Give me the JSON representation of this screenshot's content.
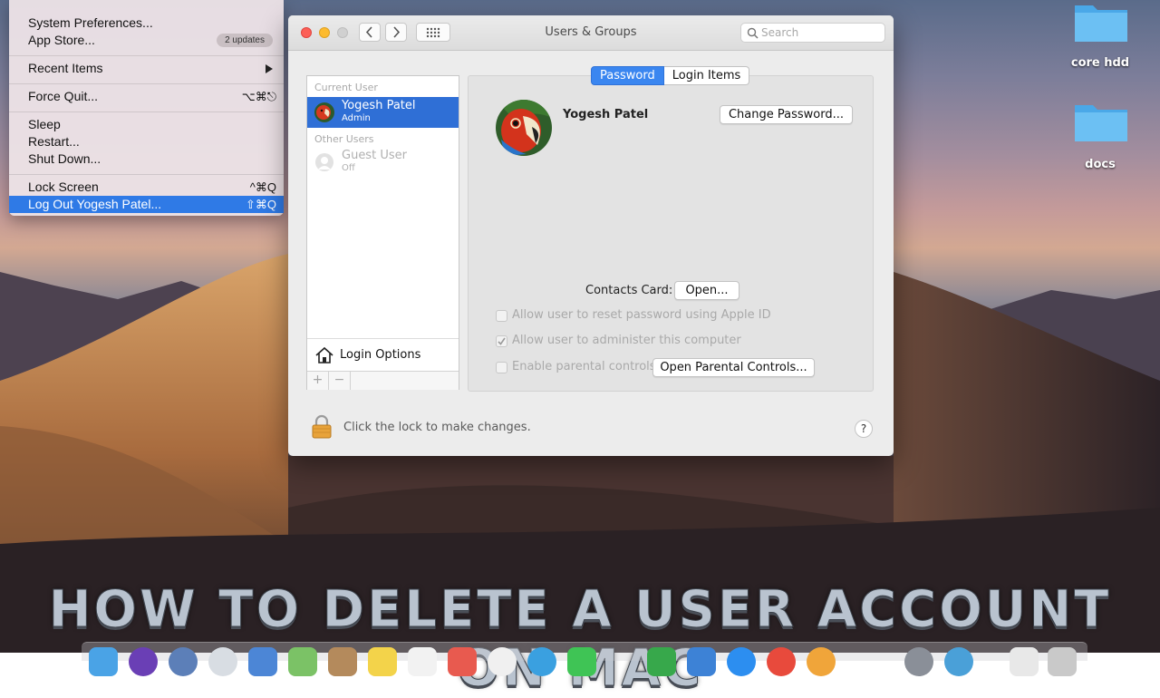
{
  "apple_menu": {
    "items": [
      {
        "label": "System Preferences...",
        "shortcut": ""
      },
      {
        "label": "App Store...",
        "badge": "2 updates"
      },
      {
        "label": "Recent Items"
      },
      {
        "label": "Force Quit...",
        "shortcut": "⌥⌘⎋"
      },
      {
        "label": "Sleep"
      },
      {
        "label": "Restart..."
      },
      {
        "label": "Shut Down..."
      },
      {
        "label": "Lock Screen",
        "shortcut": "^⌘Q"
      },
      {
        "label": "Log Out Yogesh Patel...",
        "shortcut": "⇧⌘Q"
      }
    ]
  },
  "window": {
    "title": "Users & Groups",
    "search_placeholder": "Search",
    "user_list": {
      "current_user_header": "Current User",
      "current_user": {
        "name": "Yogesh Patel",
        "role": "Admin"
      },
      "other_users_header": "Other Users",
      "guest_user": {
        "name": "Guest User",
        "status": "Off"
      },
      "login_options": "Login Options",
      "add_label": "+",
      "remove_label": "−"
    },
    "tabs": [
      {
        "label": "Password",
        "active": true
      },
      {
        "label": "Login Items",
        "active": false
      }
    ],
    "full_name": "Yogesh Patel",
    "change_password_label": "Change Password...",
    "contacts_card_label": "Contacts Card:",
    "open_label": "Open...",
    "checkboxes": [
      {
        "label": "Allow user to reset password using Apple ID",
        "checked": false
      },
      {
        "label": "Allow user to administer this computer",
        "checked": true
      },
      {
        "label": "Enable parental controls",
        "checked": false
      }
    ],
    "open_parental_controls_label": "Open Parental Controls...",
    "lock_text": "Click the lock to make changes.",
    "help_label": "?"
  },
  "desktop_icons": [
    {
      "label": "core hdd"
    },
    {
      "label": "docs"
    }
  ],
  "banner_text": "HOW TO DELETE A USER ACCOUNT ON MAC",
  "colors": {
    "accent": "#2f7ae6",
    "folder": "#5fb8ef"
  }
}
